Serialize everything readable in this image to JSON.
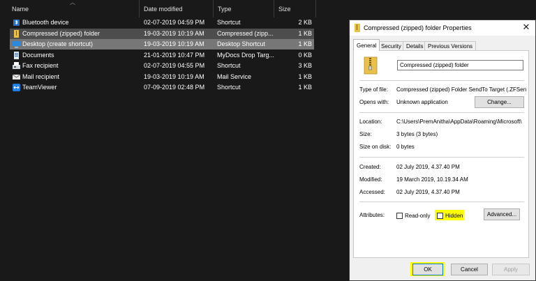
{
  "columns": {
    "name": "Name",
    "date": "Date modified",
    "type": "Type",
    "size": "Size"
  },
  "files": [
    {
      "name": "Bluetooth device",
      "date": "02-07-2019 04:59 PM",
      "type": "Shortcut",
      "size": "2 KB",
      "icon": "bluetooth-icon"
    },
    {
      "name": "Compressed (zipped) folder",
      "date": "19-03-2019 10:19 AM",
      "type": "Compressed (zipp...",
      "size": "1 KB",
      "icon": "zip-folder-icon"
    },
    {
      "name": "Desktop (create shortcut)",
      "date": "19-03-2019 10:19 AM",
      "type": "Desktop Shortcut",
      "size": "1 KB",
      "icon": "desktop-icon"
    },
    {
      "name": "Documents",
      "date": "21-01-2019 10:47 PM",
      "type": "MyDocs Drop Targ...",
      "size": "0 KB",
      "icon": "documents-icon"
    },
    {
      "name": "Fax recipient",
      "date": "02-07-2019 04:55 PM",
      "type": "Shortcut",
      "size": "3 KB",
      "icon": "fax-icon"
    },
    {
      "name": "Mail recipient",
      "date": "19-03-2019 10:19 AM",
      "type": "Mail Service",
      "size": "1 KB",
      "icon": "mail-icon"
    },
    {
      "name": "TeamViewer",
      "date": "07-09-2019 02:48 PM",
      "type": "Shortcut",
      "size": "1 KB",
      "icon": "teamviewer-icon"
    }
  ],
  "dialog": {
    "title": "Compressed (zipped) folder Properties",
    "close": "✕",
    "tabs": [
      "General",
      "Security",
      "Details",
      "Previous Versions"
    ],
    "file_name": "Compressed (zipped) folder",
    "type_label": "Type of file:",
    "type_value": "Compressed (zipped) Folder SendTo Target (.ZFSen",
    "opens_label": "Opens with:",
    "opens_value": "Unknown application",
    "change_label": "Change...",
    "location_label": "Location:",
    "location_value": "C:\\Users\\PremAnitha\\AppData\\Roaming\\Microsoft\\",
    "size_label": "Size:",
    "size_value": "3 bytes (3 bytes)",
    "disk_label": "Size on disk:",
    "disk_value": "0 bytes",
    "created_label": "Created:",
    "created_value": "02 July 2019, 4.37.40 PM",
    "modified_label": "Modified:",
    "modified_value": "19 March 2019, 10.19.34 AM",
    "accessed_label": "Accessed:",
    "accessed_value": "02 July 2019, 4.37.40 PM",
    "attributes_label": "Attributes:",
    "readonly_label": "Read-only",
    "hidden_label": "Hidden",
    "advanced_label": "Advanced...",
    "ok_label": "OK",
    "cancel_label": "Cancel",
    "apply_label": "Apply"
  },
  "colors": {
    "background": "#191919",
    "selected_row": "#777777",
    "highlight": "#ffff00",
    "accent": "#0078d7"
  }
}
